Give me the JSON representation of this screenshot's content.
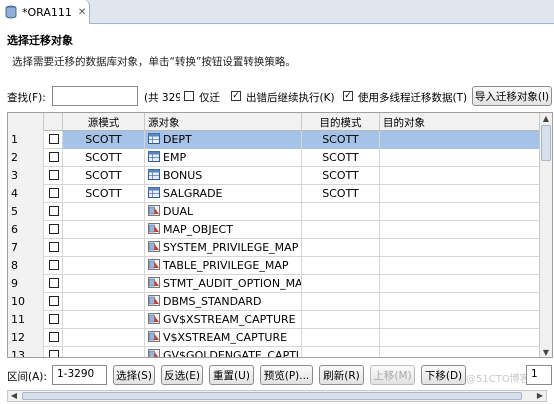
{
  "tab": {
    "title": "*ORA111",
    "close_glyph": "✕"
  },
  "section": {
    "title": "选择迁移对象",
    "description": "选择需要迁移的数据库对象，单击“转换”按钮设置转换策略。"
  },
  "toolbar": {
    "find_label": "查找(F):",
    "find_value": "",
    "count_text": "(共 329",
    "only_migrate_label": "仅迁",
    "only_migrate_checked": false,
    "continue_on_error_label": "出错后继续执行(K)",
    "continue_on_error_checked": true,
    "multithread_label": "使用多线程迁移数据(T)",
    "multithread_checked": true,
    "import_button": "导入迁移对象(I)"
  },
  "grid": {
    "headers": [
      "",
      "",
      "源模式",
      "源对象",
      "目的模式",
      "目的对象"
    ],
    "rows": [
      {
        "num": "1",
        "src_schema": "SCOTT",
        "src_obj": "DEPT",
        "dst_schema": "SCOTT",
        "dst_obj": "",
        "icon": "table-icon",
        "selected": true
      },
      {
        "num": "2",
        "src_schema": "SCOTT",
        "src_obj": "EMP",
        "dst_schema": "SCOTT",
        "dst_obj": "",
        "icon": "table-icon",
        "selected": false
      },
      {
        "num": "3",
        "src_schema": "SCOTT",
        "src_obj": "BONUS",
        "dst_schema": "SCOTT",
        "dst_obj": "",
        "icon": "table-icon",
        "selected": false
      },
      {
        "num": "4",
        "src_schema": "SCOTT",
        "src_obj": "SALGRADE",
        "dst_schema": "SCOTT",
        "dst_obj": "",
        "icon": "table-icon",
        "selected": false
      },
      {
        "num": "5",
        "src_schema": "",
        "src_obj": "DUAL",
        "dst_schema": "",
        "dst_obj": "",
        "icon": "view-icon",
        "selected": false
      },
      {
        "num": "6",
        "src_schema": "",
        "src_obj": "MAP_OBJECT",
        "dst_schema": "",
        "dst_obj": "",
        "icon": "view-icon",
        "selected": false
      },
      {
        "num": "7",
        "src_schema": "",
        "src_obj": "SYSTEM_PRIVILEGE_MAP",
        "dst_schema": "",
        "dst_obj": "",
        "icon": "view-icon",
        "selected": false
      },
      {
        "num": "8",
        "src_schema": "",
        "src_obj": "TABLE_PRIVILEGE_MAP",
        "dst_schema": "",
        "dst_obj": "",
        "icon": "view-icon",
        "selected": false
      },
      {
        "num": "9",
        "src_schema": "",
        "src_obj": "STMT_AUDIT_OPTION_MA...",
        "dst_schema": "",
        "dst_obj": "",
        "icon": "view-icon",
        "selected": false
      },
      {
        "num": "10",
        "src_schema": "",
        "src_obj": "DBMS_STANDARD",
        "dst_schema": "",
        "dst_obj": "",
        "icon": "view-icon",
        "selected": false
      },
      {
        "num": "11",
        "src_schema": "",
        "src_obj": "GV$XSTREAM_CAPTURE",
        "dst_schema": "",
        "dst_obj": "",
        "icon": "view-icon",
        "selected": false
      },
      {
        "num": "12",
        "src_schema": "",
        "src_obj": "V$XSTREAM_CAPTURE",
        "dst_schema": "",
        "dst_obj": "",
        "icon": "view-icon",
        "selected": false
      },
      {
        "num": "13",
        "src_schema": "",
        "src_obj": "GV$GOLDENGATE_CAPTUR",
        "dst_schema": "",
        "dst_obj": "",
        "icon": "view-icon",
        "selected": false
      }
    ]
  },
  "bottom": {
    "range_label": "区间(A):",
    "range_value": "1-3290",
    "select_btn": "选择(S)",
    "invert_btn": "反选(E)",
    "reset_btn": "重置(U)",
    "preview_btn": "预览(P)...",
    "refresh_btn": "刷新(R)",
    "move_up_btn": "上移(M)",
    "move_down_btn": "下移(D)",
    "watermark": "@51CTO博客",
    "page_value": "1"
  },
  "colors": {
    "selection": "#a5c3e6",
    "tabbar": "#dfe6ee"
  }
}
